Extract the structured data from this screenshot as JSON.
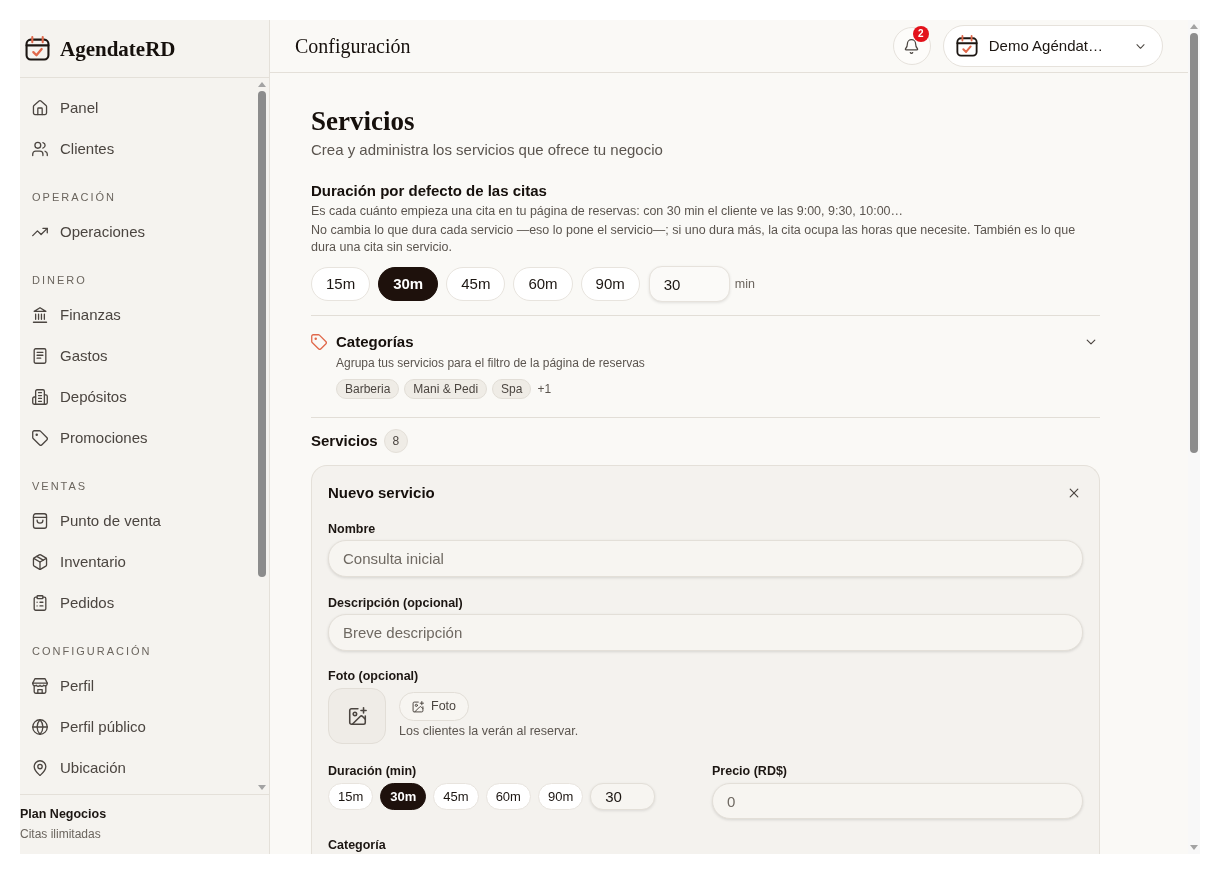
{
  "sidebar": {
    "brand": "AgendateRD",
    "sections": [
      {
        "items": [
          {
            "label": "Panel",
            "selected": false
          },
          {
            "label": "Clientes",
            "selected": false
          }
        ]
      },
      {
        "heading": "OPERACIÓN",
        "items": [
          {
            "label": "Operaciones",
            "selected": false
          }
        ]
      },
      {
        "heading": "DINERO",
        "items": [
          {
            "label": "Finanzas",
            "selected": false
          },
          {
            "label": "Gastos",
            "selected": false
          },
          {
            "label": "Depósitos",
            "selected": false
          },
          {
            "label": "Promociones",
            "selected": false
          }
        ]
      },
      {
        "heading": "VENTAS",
        "items": [
          {
            "label": "Punto de venta",
            "selected": false
          },
          {
            "label": "Inventario",
            "selected": false
          },
          {
            "label": "Pedidos",
            "selected": false
          }
        ]
      },
      {
        "heading": "CONFIGURACIÓN",
        "items": [
          {
            "label": "Perfil",
            "selected": false
          },
          {
            "label": "Perfil público",
            "selected": false
          },
          {
            "label": "Ubicación",
            "selected": false
          }
        ]
      }
    ],
    "plan": {
      "name": "Plan Negocios",
      "detail": "Citas ilimitadas"
    }
  },
  "header": {
    "title": "Configuración",
    "notification_count": "2",
    "account": "Demo Agéndat…"
  },
  "page": {
    "title": "Servicios",
    "subtitle": "Crea y administra los servicios que ofrece tu negocio"
  },
  "default_duration": {
    "title": "Duración por defecto de las citas",
    "notes": [
      "Es cada cuánto empieza una cita en tu página de reservas: con 30 min el cliente ve las 9:00, 9:30, 10:00…",
      "No cambia lo que dura cada servicio —eso lo pone el servicio—; si uno dura más, la cita ocupa las horas que necesite. También es lo que dura una cita sin servicio."
    ],
    "options": [
      {
        "label": "15m",
        "selected": false
      },
      {
        "label": "30m",
        "selected": true
      },
      {
        "label": "45m",
        "selected": false
      },
      {
        "label": "60m",
        "selected": false
      },
      {
        "label": "90m",
        "selected": false
      }
    ],
    "value": "30",
    "unit": "min"
  },
  "categories": {
    "title": "Categorías",
    "description": "Agrupa tus servicios para el filtro de la página de reservas",
    "expanded": false,
    "tags": [
      "Barberia",
      "Mani & Pedi",
      "Spa"
    ],
    "more": "+1"
  },
  "services": {
    "title": "Servicios",
    "count": "8"
  },
  "new_service": {
    "title": "Nuevo servicio",
    "name": {
      "label": "Nombre",
      "placeholder": "Consulta inicial"
    },
    "description": {
      "label": "Descripción (opcional)",
      "placeholder": "Breve descripción"
    },
    "photo": {
      "label": "Foto (opcional)",
      "button": "Foto",
      "hint": "Los clientes la verán al reservar."
    },
    "duration": {
      "label": "Duración (min)",
      "options": [
        {
          "label": "15m",
          "selected": false
        },
        {
          "label": "30m",
          "selected": true
        },
        {
          "label": "45m",
          "selected": false
        },
        {
          "label": "60m",
          "selected": false
        },
        {
          "label": "90m",
          "selected": false
        }
      ],
      "value": "30"
    },
    "price": {
      "label": "Precio (RD$)",
      "placeholder": "0"
    },
    "category": {
      "label": "Categoría"
    }
  }
}
